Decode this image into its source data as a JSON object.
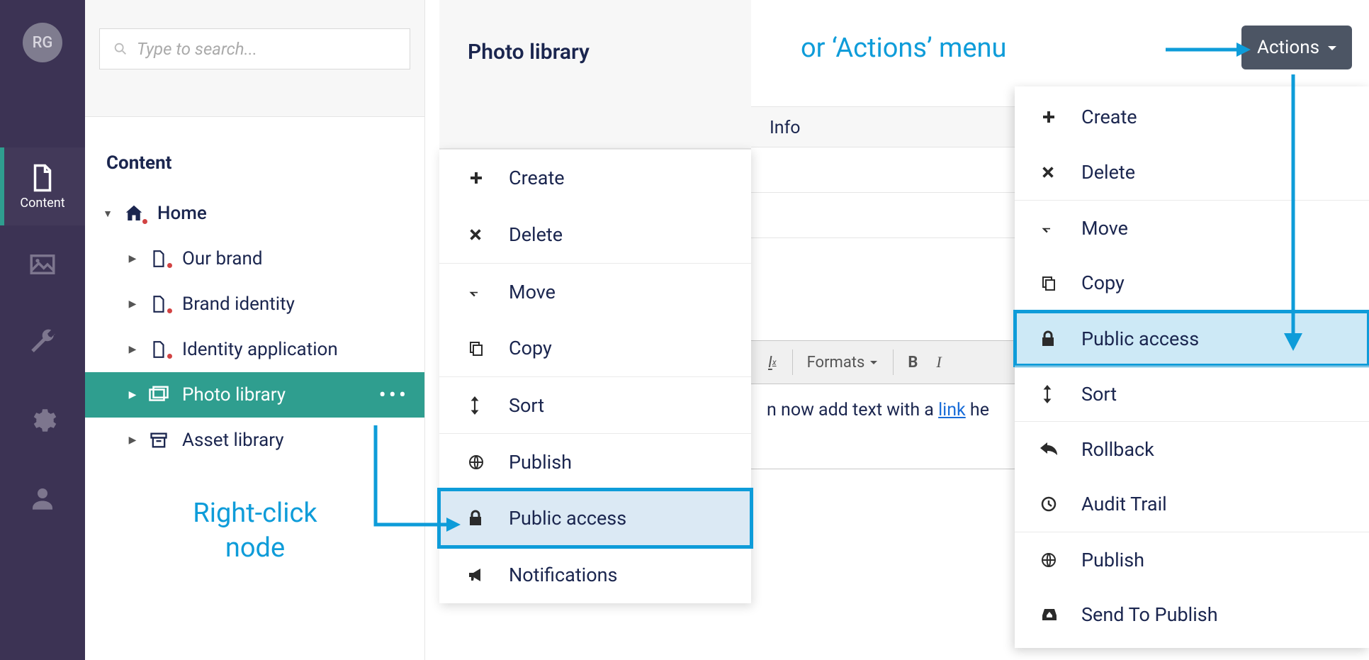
{
  "avatar_initials": "RG",
  "search": {
    "placeholder": "Type to search..."
  },
  "nav": {
    "content_label": "Content"
  },
  "tree": {
    "section": "Content",
    "home": "Home",
    "items": [
      {
        "label": "Our brand"
      },
      {
        "label": "Brand identity"
      },
      {
        "label": "Identity application"
      },
      {
        "label": "Photo library"
      },
      {
        "label": "Asset library"
      }
    ]
  },
  "context_menu": {
    "title": "Photo library",
    "items": {
      "create": "Create",
      "delete": "Delete",
      "move": "Move",
      "copy": "Copy",
      "sort": "Sort",
      "publish": "Publish",
      "public_access": "Public access",
      "notifications": "Notifications"
    }
  },
  "content": {
    "tab_info": "Info",
    "formats_label": "Formats",
    "editor_pre": "n now add text with a ",
    "editor_link": "link",
    "editor_post": " he"
  },
  "actions": {
    "button_label": "Actions",
    "items": {
      "create": "Create",
      "delete": "Delete",
      "move": "Move",
      "copy": "Copy",
      "public_access": "Public access",
      "sort": "Sort",
      "rollback": "Rollback",
      "audit_trail": "Audit Trail",
      "publish": "Publish",
      "send_to_publish": "Send To Publish"
    }
  },
  "annotations": {
    "right_click": "Right-click node",
    "or_actions": "or ‘Actions’ menu"
  }
}
